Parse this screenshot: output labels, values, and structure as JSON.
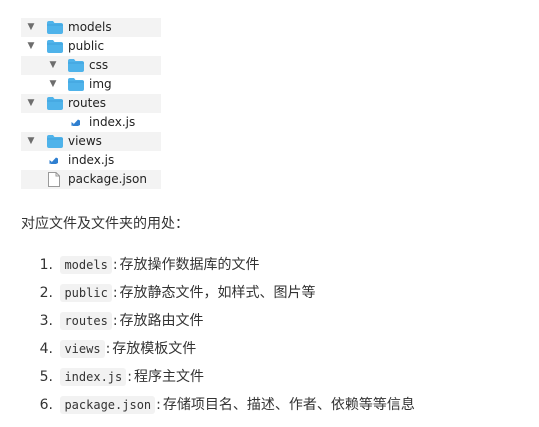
{
  "tree": {
    "items": [
      {
        "name": "models",
        "type": "folder"
      },
      {
        "name": "public",
        "type": "folder"
      },
      {
        "name": "css",
        "type": "folder"
      },
      {
        "name": "img",
        "type": "folder"
      },
      {
        "name": "routes",
        "type": "folder"
      },
      {
        "name": "index.js",
        "type": "js-file"
      },
      {
        "name": "views",
        "type": "folder"
      },
      {
        "name": "index.js",
        "type": "js-file"
      },
      {
        "name": "package.json",
        "type": "file"
      }
    ]
  },
  "intro": "对应文件及文件夹的用处：",
  "list": {
    "items": [
      {
        "number": "1.",
        "code": "models",
        "sep": ":",
        "text": "存放操作数据库的文件"
      },
      {
        "number": "2.",
        "code": "public",
        "sep": ":",
        "text": "存放静态文件，如样式、图片等"
      },
      {
        "number": "3.",
        "code": "routes",
        "sep": ":",
        "text": "存放路由文件"
      },
      {
        "number": "4.",
        "code": "views",
        "sep": ":",
        "text": "存放模板文件"
      },
      {
        "number": "5.",
        "code": "index.js",
        "sep": ":",
        "text": "程序主文件"
      },
      {
        "number": "6.",
        "code": "package.json",
        "sep": ":",
        "text": "存储项目名、描述、作者、依赖等等信息"
      }
    ]
  },
  "colors": {
    "folder": "#4fb3ea",
    "folder_tab": "#3fa2dc",
    "js_icon": "#2f7fd0",
    "row_shade": "#f3f3f3",
    "code_bg": "#f2f2f2"
  },
  "icons": {
    "expanded": "disclosure-triangle-icon",
    "folder": "folder-icon",
    "js_file": "javascript-file-icon",
    "file": "file-icon"
  }
}
